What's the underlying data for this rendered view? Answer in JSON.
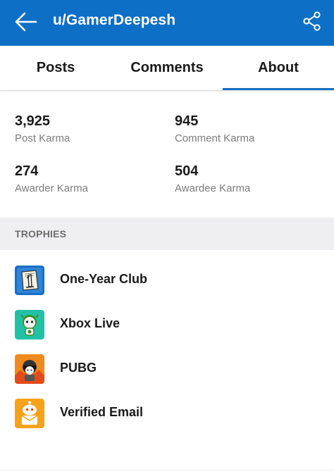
{
  "header": {
    "title": "u/GamerDeepesh",
    "back_icon": "arrow-left-icon",
    "share_icon": "share-icon",
    "background": "#0d6fc5"
  },
  "tabs": [
    {
      "label": "Posts"
    },
    {
      "label": "Comments"
    },
    {
      "label": "About",
      "active": true
    }
  ],
  "stats": [
    {
      "value": "3,925",
      "label": "Post Karma"
    },
    {
      "value": "945",
      "label": "Comment Karma"
    },
    {
      "value": "274",
      "label": "Awarder Karma"
    },
    {
      "value": "504",
      "label": "Awardee Karma"
    }
  ],
  "trophies_section": {
    "heading": "TROPHIES",
    "items": [
      {
        "name": "One-Year Club",
        "icon": "one-year-club-icon"
      },
      {
        "name": "Xbox Live",
        "icon": "xbox-live-icon"
      },
      {
        "name": "PUBG",
        "icon": "pubg-icon"
      },
      {
        "name": "Verified Email",
        "icon": "verified-email-icon"
      }
    ]
  }
}
